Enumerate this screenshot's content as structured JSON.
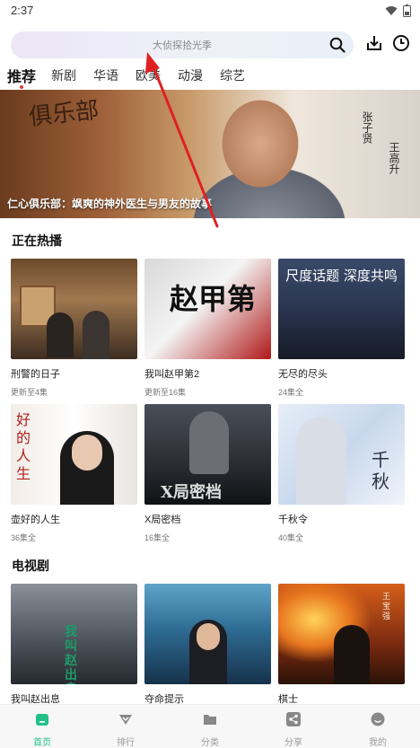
{
  "status": {
    "time": "2:37"
  },
  "search": {
    "placeholder": "大侦探拾光季"
  },
  "tabs": [
    "推荐",
    "新剧",
    "华语",
    "欧美",
    "动漫",
    "综艺"
  ],
  "banner": {
    "caption": "仁心俱乐部：飒爽的神外医生与男友的故事",
    "poster_title": "俱乐部",
    "actor_1": "张子贤",
    "actor_2": "王高升"
  },
  "sections": [
    {
      "title": "正在热播",
      "items": [
        {
          "title": "刑警的日子",
          "sub": "更新至4集",
          "poster_text": ""
        },
        {
          "title": "我叫赵甲第2",
          "sub": "更新至16集",
          "poster_text": "赵甲第"
        },
        {
          "title": "无尽的尽头",
          "sub": "24集全",
          "poster_text": "尺度话题 深度共鸣"
        },
        {
          "title": "壶好的人生",
          "sub": "36集全",
          "poster_text": "好的人生"
        },
        {
          "title": "X局密档",
          "sub": "16集全",
          "poster_text": "X局密档"
        },
        {
          "title": "千秋令",
          "sub": "40集全",
          "poster_text": "千秋"
        }
      ]
    },
    {
      "title": "电视剧",
      "items": [
        {
          "title": "我叫赵出息",
          "sub": "",
          "poster_text": "我叫赵出息"
        },
        {
          "title": "夺命提示",
          "sub": "",
          "poster_text": ""
        },
        {
          "title": "棋士",
          "sub": "",
          "poster_text": "王宝强"
        }
      ]
    }
  ],
  "nav": [
    {
      "label": "首页",
      "icon": "home-icon",
      "active": true
    },
    {
      "label": "排行",
      "icon": "ranking-icon",
      "active": false
    },
    {
      "label": "分类",
      "icon": "folder-icon",
      "active": false
    },
    {
      "label": "分享",
      "icon": "share-icon",
      "active": false
    },
    {
      "label": "我的",
      "icon": "profile-icon",
      "active": false
    }
  ],
  "colors": {
    "accent": "#22c088",
    "tab_dot": "#e03a3a",
    "arrow": "#e02020"
  }
}
